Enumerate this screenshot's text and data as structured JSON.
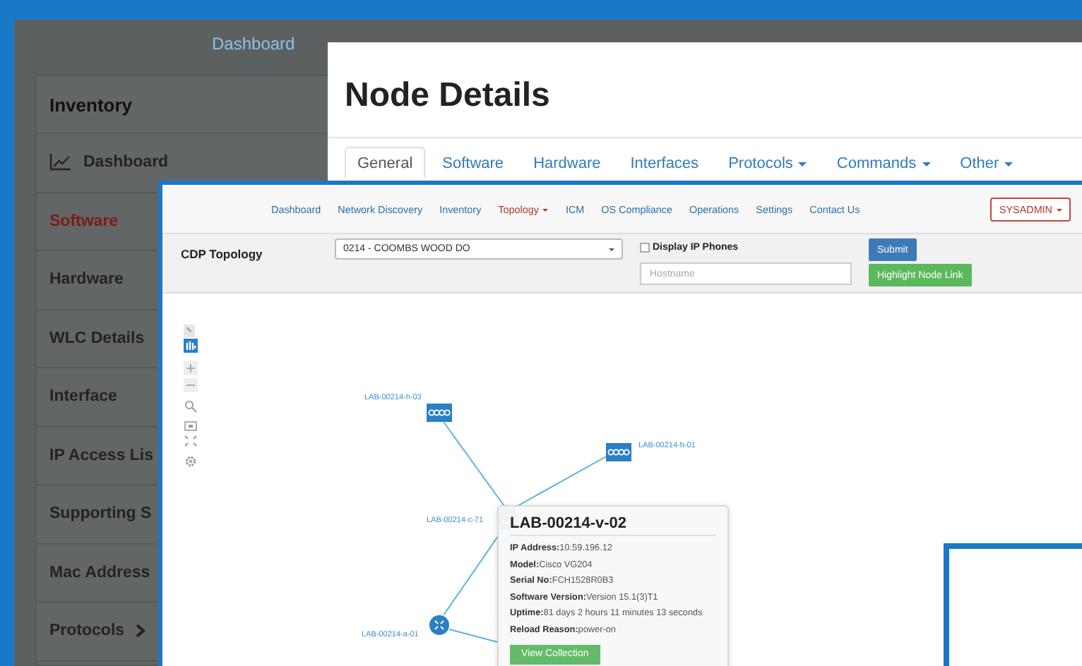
{
  "app_nav": {
    "items": [
      {
        "label": "Dashboard"
      }
    ]
  },
  "sidebar": {
    "header": "Inventory",
    "items": [
      {
        "label": "Dashboard",
        "kind": "chart",
        "selected": false,
        "has_submenu": false
      },
      {
        "label": "Software",
        "kind": "plain",
        "selected": true,
        "has_submenu": false
      },
      {
        "label": "Hardware",
        "kind": "plain",
        "selected": false,
        "has_submenu": false
      },
      {
        "label": "WLC Details",
        "kind": "plain",
        "selected": false,
        "has_submenu": false
      },
      {
        "label": "Interface",
        "kind": "plain",
        "selected": false,
        "has_submenu": false
      },
      {
        "label": "IP Access Lis",
        "kind": "plain",
        "selected": false,
        "has_submenu": false
      },
      {
        "label": "Supporting S",
        "kind": "plain",
        "selected": false,
        "has_submenu": false
      },
      {
        "label": "Mac Address",
        "kind": "plain",
        "selected": false,
        "has_submenu": false
      },
      {
        "label": "Protocols",
        "kind": "plain",
        "selected": false,
        "has_submenu": true
      }
    ]
  },
  "node_details": {
    "title": "Node Details",
    "tabs": [
      {
        "label": "General",
        "selected": true,
        "dropdown": false
      },
      {
        "label": "Software",
        "selected": false,
        "dropdown": false
      },
      {
        "label": "Hardware",
        "selected": false,
        "dropdown": false
      },
      {
        "label": "Interfaces",
        "selected": false,
        "dropdown": false
      },
      {
        "label": "Protocols",
        "selected": false,
        "dropdown": true
      },
      {
        "label": "Commands",
        "selected": false,
        "dropdown": true
      },
      {
        "label": "Other",
        "selected": false,
        "dropdown": true
      }
    ]
  },
  "topology_window": {
    "nav": [
      {
        "label": "Dashboard",
        "selected": false,
        "dropdown": false
      },
      {
        "label": "Network Discovery",
        "selected": false,
        "dropdown": false
      },
      {
        "label": "Inventory",
        "selected": false,
        "dropdown": false
      },
      {
        "label": "Topology",
        "selected": true,
        "dropdown": true
      },
      {
        "label": "ICM",
        "selected": false,
        "dropdown": false
      },
      {
        "label": "OS Compliance",
        "selected": false,
        "dropdown": false
      },
      {
        "label": "Operations",
        "selected": false,
        "dropdown": false
      },
      {
        "label": "Settings",
        "selected": false,
        "dropdown": false
      },
      {
        "label": "Contact Us",
        "selected": false,
        "dropdown": false
      }
    ],
    "user_menu": "SYSADMIN",
    "panel_title": "CDP Topology",
    "site_select": "0214 - COOMBS WOOD DO",
    "display_ip_phones": {
      "label": "Display IP Phones",
      "checked": false
    },
    "hostname": {
      "placeholder": "Hostname"
    },
    "buttons": [
      {
        "label": "Submit",
        "kind": "primary"
      },
      {
        "label": "Highlight Node Link",
        "kind": "success"
      }
    ],
    "nodes": [
      {
        "label": "LAB-00214-h-03",
        "kind": "hub"
      },
      {
        "label": "LAB-00214-h-01",
        "kind": "hub"
      },
      {
        "label": "LAB-00214-c-71",
        "kind": "switch"
      },
      {
        "label": "LAB-00214-a-01",
        "kind": "router"
      }
    ],
    "tooltip": {
      "title": "LAB-00214-v-02",
      "lines": [
        "**IP Address:**10.59.196.12",
        "**Model:**Cisco VG204",
        "**Serial No:**FCH1528R0B3",
        "**Software Version:**Version 15.1(3)T1",
        "**Uptime:**81 days 2 hours 11 minutes 13 seconds",
        "**Reload Reason:**power-on"
      ],
      "button": "View Collection"
    }
  }
}
